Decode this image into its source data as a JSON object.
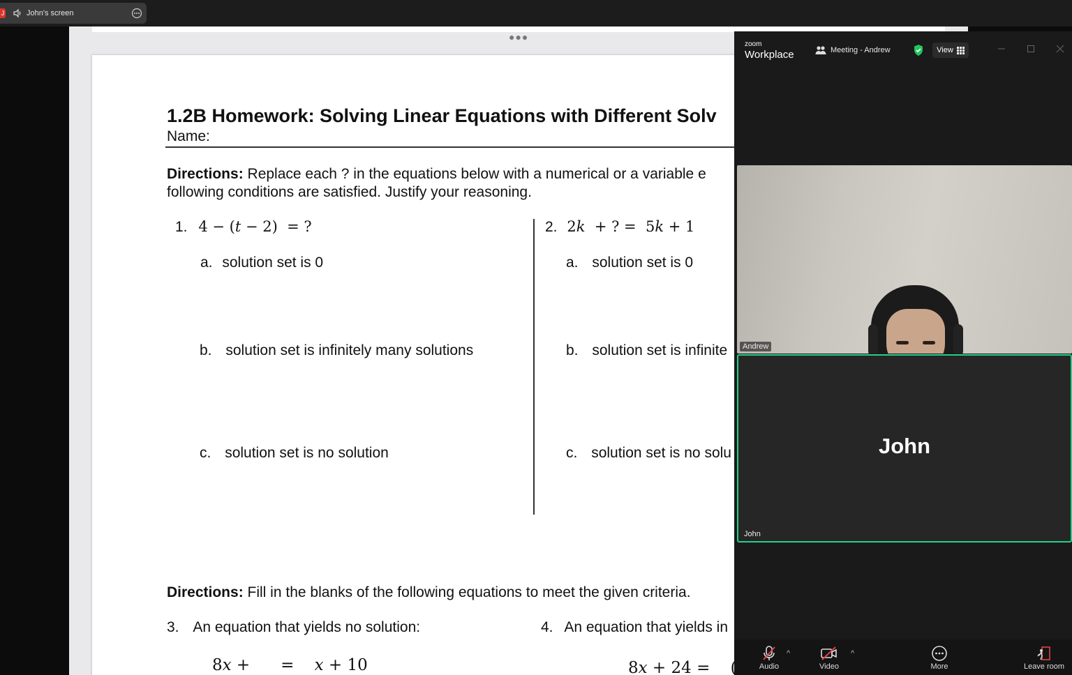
{
  "share_bar": {
    "badge": "J",
    "title": "John's screen"
  },
  "document": {
    "title": "1.2B Homework: Solving Linear Equations with Different Solv",
    "name_label": "Name:",
    "directions1_bold": "Directions:",
    "directions1_line1": " Replace each ?  in the equations below with a numerical or a variable e",
    "directions1_line2": "following conditions are satisfied. Justify your reasoning.",
    "problems": [
      {
        "number": "1.",
        "a": "a.",
        "a_text": "solution set is 0",
        "b": "b.",
        "b_text": "solution set is infinitely many solutions",
        "c": "c.",
        "c_text": "solution set is no solution"
      },
      {
        "number": "2.",
        "a": "a.",
        "a_text": "solution set is 0",
        "b": "b.",
        "b_text": "solution set is infinite",
        "c": "c.",
        "c_text": "solution set is no solu"
      }
    ],
    "directions2_bold": "Directions:",
    "directions2_text": " Fill in the blanks of the following equations to meet the given criteria.",
    "q3_number": "3.",
    "q3_text": "An equation that yields no solution:",
    "q4_number": "4.",
    "q4_text": "An equation that yields in"
  },
  "zoom": {
    "logo_small": "zoom",
    "logo": "Workplace",
    "meeting_label": "Meeting - Andrew",
    "view_label": "View",
    "participants": [
      {
        "label": "Andrew"
      },
      {
        "label": "John",
        "display_name": "John"
      }
    ],
    "toolbar": {
      "audio": "Audio",
      "video": "Video",
      "more": "More",
      "leave": "Leave room"
    },
    "colors": {
      "active_speaker_border": "#23d18b",
      "shield": "#22c55e",
      "muted_red": "#e0424a"
    }
  }
}
